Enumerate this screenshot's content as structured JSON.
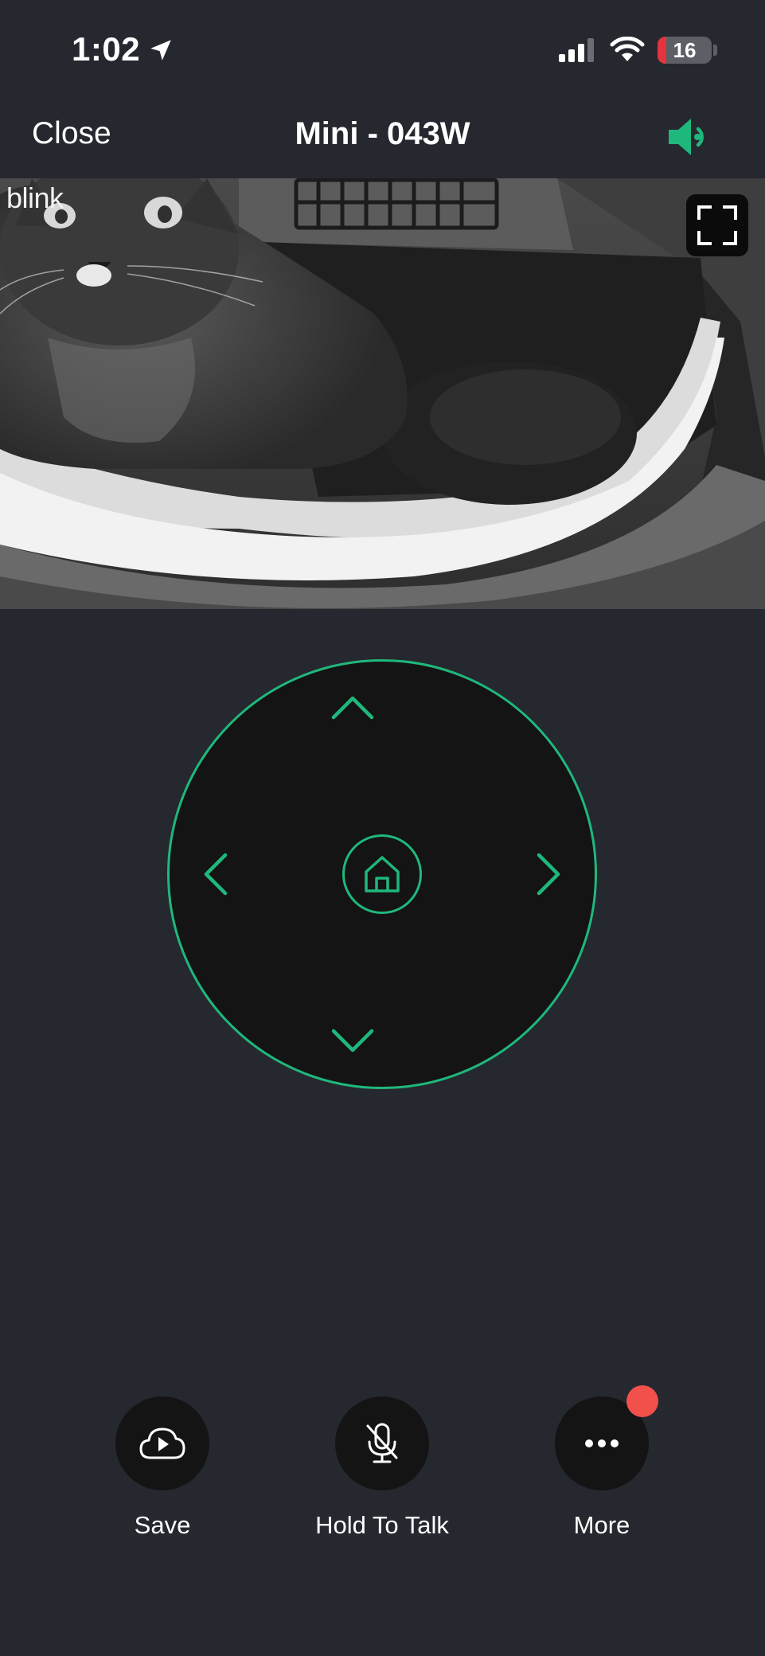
{
  "status_bar": {
    "time": "1:02",
    "battery_level": "16",
    "battery_fraction": 0.16,
    "icons": [
      "location-arrow-icon",
      "cellular-signal-icon",
      "wifi-icon",
      "battery-icon"
    ]
  },
  "nav": {
    "close_label": "Close",
    "title": "Mini - 043W",
    "speaker_icon": "speaker-volume-icon"
  },
  "video": {
    "watermark": "blink",
    "fullscreen_icon": "fullscreen-icon"
  },
  "joystick": {
    "up_icon": "chevron-up-icon",
    "down_icon": "chevron-down-icon",
    "left_icon": "chevron-left-icon",
    "right_icon": "chevron-right-icon",
    "home_icon": "home-icon"
  },
  "actions": [
    {
      "label": "Save",
      "icon": "cloud-play-icon"
    },
    {
      "label": "Hold To Talk",
      "icon": "microphone-muted-icon"
    },
    {
      "label": "More",
      "icon": "ellipsis-icon",
      "has_notification": true
    }
  ],
  "colors": {
    "accent": "#1fb87c",
    "background": "#25282e",
    "button_bg": "#141414",
    "notification": "#f2504b",
    "battery_low": "#e5343d"
  }
}
